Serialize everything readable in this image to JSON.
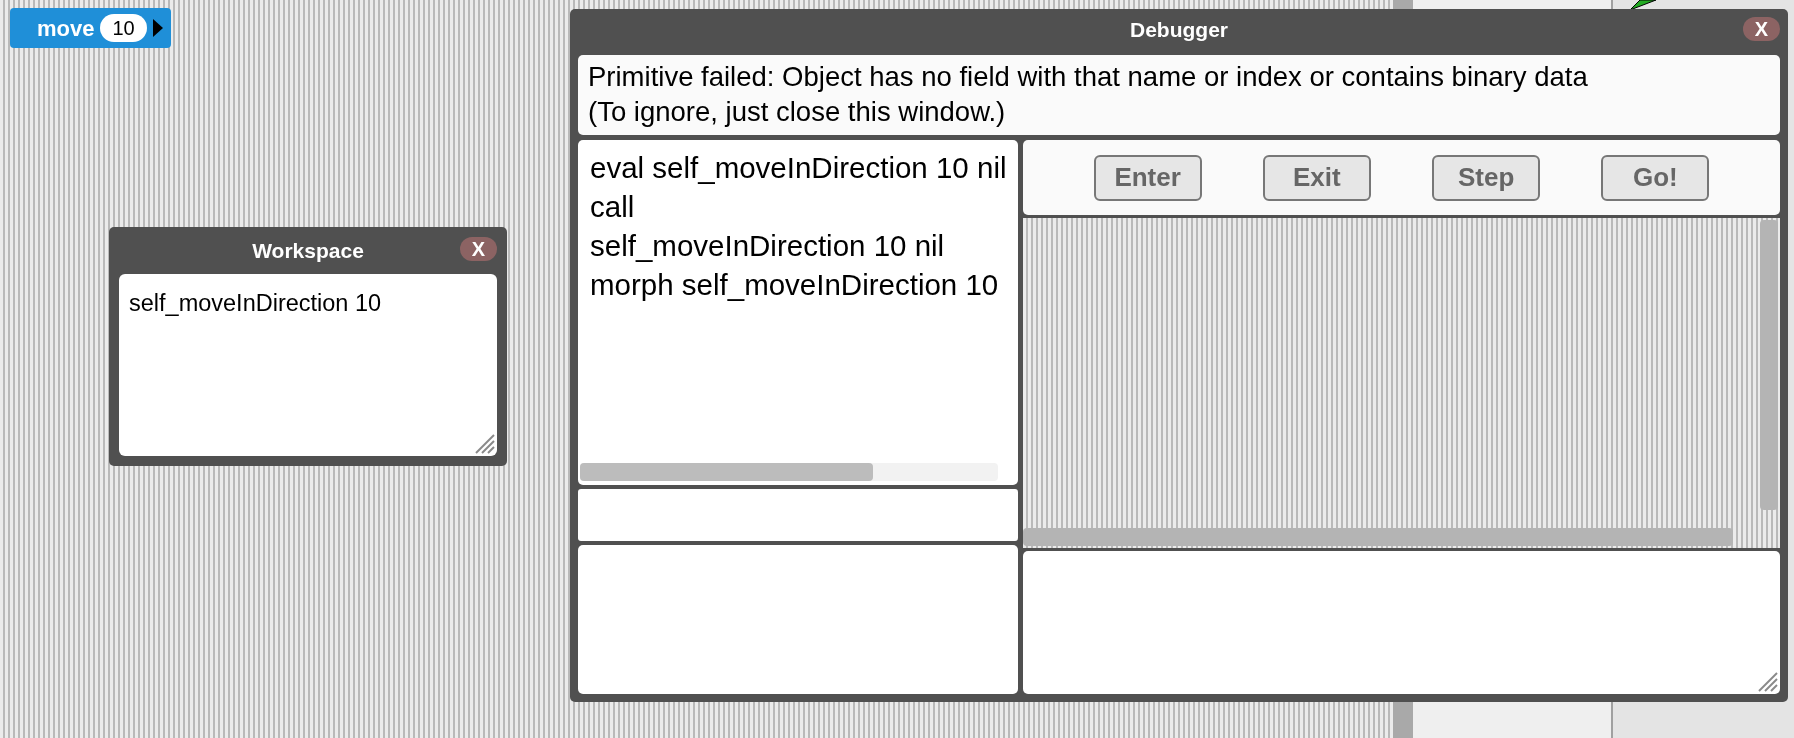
{
  "block": {
    "label": "move",
    "value": "10"
  },
  "workspace": {
    "title": "Workspace",
    "close": "X",
    "text": "self_moveInDirection 10"
  },
  "debugger": {
    "title": "Debugger",
    "close": "X",
    "message": [
      "Primitive failed: Object has no field with that name or index or contains binary data",
      "(To ignore, just close this window.)"
    ],
    "stack": [
      "eval self_moveInDirection 10 nil",
      "call",
      "self_moveInDirection 10 nil",
      "morph self_moveInDirection 10"
    ],
    "buttons": [
      "Enter",
      "Exit",
      "Step",
      "Go!"
    ]
  }
}
